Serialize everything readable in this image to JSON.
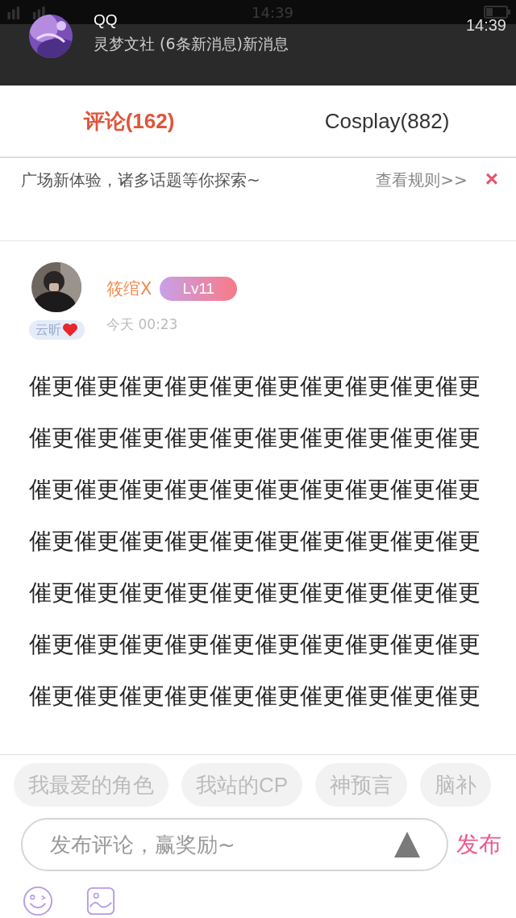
{
  "status_bar": {
    "time": "14:39"
  },
  "notification": {
    "app": "QQ",
    "message": "灵梦文社 (6条新消息)新消息",
    "time": "14:39"
  },
  "tabs": [
    {
      "label": "评论(162)",
      "selected": true
    },
    {
      "label": "Cosplay(882)",
      "selected": false
    }
  ],
  "notice": {
    "text": "广场新体验，诸多话题等你探索~",
    "link": "查看规则>>",
    "close": "×"
  },
  "comment": {
    "author": "筱绾X",
    "level_badge": "Lv11",
    "tag": "云昕",
    "time": "今天 00:23",
    "lines": [
      "催更催更催更催更催更催更催更催更催更催更",
      "催更催更催更催更催更催更催更催更催更催更",
      "催更催更催更催更催更催更催更催更催更催更",
      "催更催更催更催更催更催更催更催更催更催更",
      "催更催更催更催更催更催更催更催更催更催更",
      "催更催更催更催更催更催更催更催更催更催更",
      "催更催更催更催更催更催更催更催更催更催更"
    ]
  },
  "topic_chips": [
    "我最爱的角色",
    "我站的CP",
    "神预言",
    "脑补"
  ],
  "composer": {
    "placeholder": "发布评论，赢奖励~",
    "send": "发布"
  }
}
